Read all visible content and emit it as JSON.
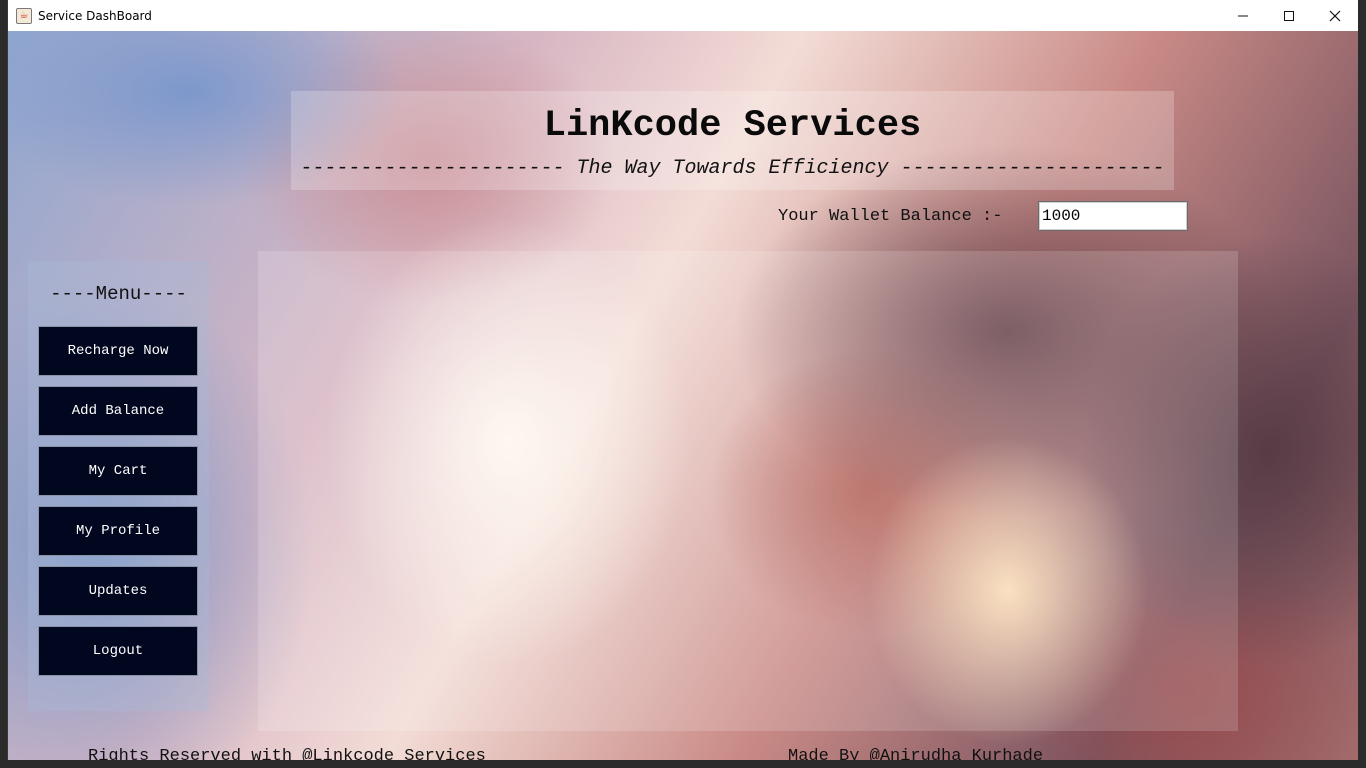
{
  "window": {
    "title": "Service DashBoard",
    "app_icon": "java-cup-icon",
    "controls": {
      "minimize": "—",
      "maximize": "☐",
      "close": "✕"
    }
  },
  "header": {
    "title": "LinKcode Services",
    "tagline": "---------------------- The Way Towards Efficiency ----------------------"
  },
  "wallet": {
    "label": "Your Wallet Balance :-",
    "value": "1000"
  },
  "menu": {
    "title": "----Menu----",
    "items": [
      {
        "label": "Recharge Now"
      },
      {
        "label": "Add Balance"
      },
      {
        "label": "My Cart"
      },
      {
        "label": "My Profile"
      },
      {
        "label": "Updates"
      },
      {
        "label": "Logout"
      }
    ]
  },
  "footer": {
    "left": "Rights Reserved with @Linkcode Services",
    "right": "Made By @Anirudha Kurhade"
  }
}
